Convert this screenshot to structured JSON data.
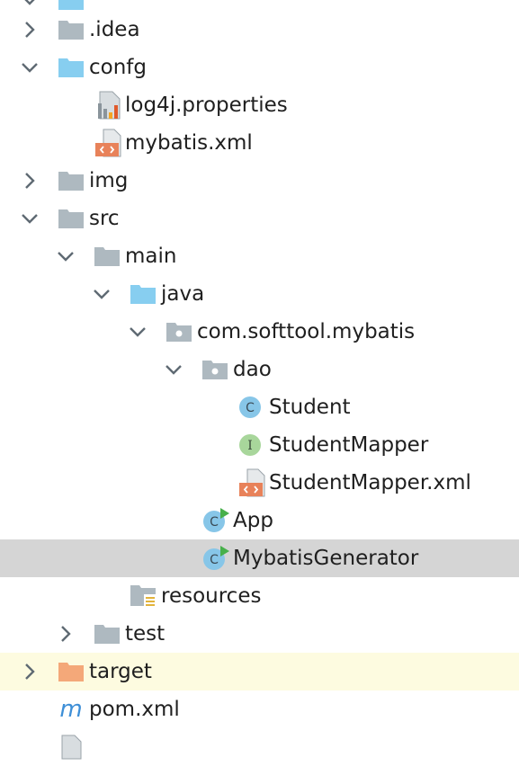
{
  "tree": {
    "items": [
      {
        "label": "",
        "icon": "folder-icon",
        "expand": "expanded"
      },
      {
        "label": ".idea",
        "icon": "folder-icon",
        "expand": "collapsed"
      },
      {
        "label": "confg",
        "icon": "source-folder-icon",
        "expand": "expanded"
      },
      {
        "label": "log4j.properties",
        "icon": "properties-file-icon",
        "expand": "none"
      },
      {
        "label": "mybatis.xml",
        "icon": "xml-file-icon",
        "expand": "none"
      },
      {
        "label": "img",
        "icon": "folder-icon",
        "expand": "collapsed"
      },
      {
        "label": "src",
        "icon": "folder-icon",
        "expand": "expanded"
      },
      {
        "label": "main",
        "icon": "folder-icon",
        "expand": "expanded"
      },
      {
        "label": "java",
        "icon": "source-folder-icon",
        "expand": "expanded"
      },
      {
        "label": "com.softtool.mybatis",
        "icon": "package-icon",
        "expand": "expanded"
      },
      {
        "label": "dao",
        "icon": "package-icon",
        "expand": "expanded"
      },
      {
        "label": "Student",
        "icon": "class-icon",
        "expand": "none"
      },
      {
        "label": "StudentMapper",
        "icon": "interface-icon",
        "expand": "none"
      },
      {
        "label": "StudentMapper.xml",
        "icon": "xml-file-icon",
        "expand": "none"
      },
      {
        "label": "App",
        "icon": "runnable-class-icon",
        "expand": "none"
      },
      {
        "label": "MybatisGenerator",
        "icon": "runnable-class-icon",
        "expand": "none",
        "selected": true
      },
      {
        "label": "resources",
        "icon": "resources-folder-icon",
        "expand": "none"
      },
      {
        "label": "test",
        "icon": "folder-icon",
        "expand": "collapsed"
      },
      {
        "label": "target",
        "icon": "excluded-folder-icon",
        "expand": "collapsed"
      },
      {
        "label": "pom.xml",
        "icon": "maven-icon",
        "expand": "none"
      },
      {
        "label": "",
        "icon": "file-icon",
        "expand": "none"
      }
    ]
  },
  "colors": {
    "selected_row": "#d5d5d5",
    "highlight_row": "#fdfbe0",
    "folder": "#aeb9c0",
    "source_folder": "#87cef0",
    "excluded_folder": "#f4a879",
    "class_icon": "#87c6e8",
    "interface_icon": "#a8d69b",
    "xml_icon": "#e8825a",
    "run_marker": "#47b04b",
    "maven_icon": "#3e8fd7"
  }
}
